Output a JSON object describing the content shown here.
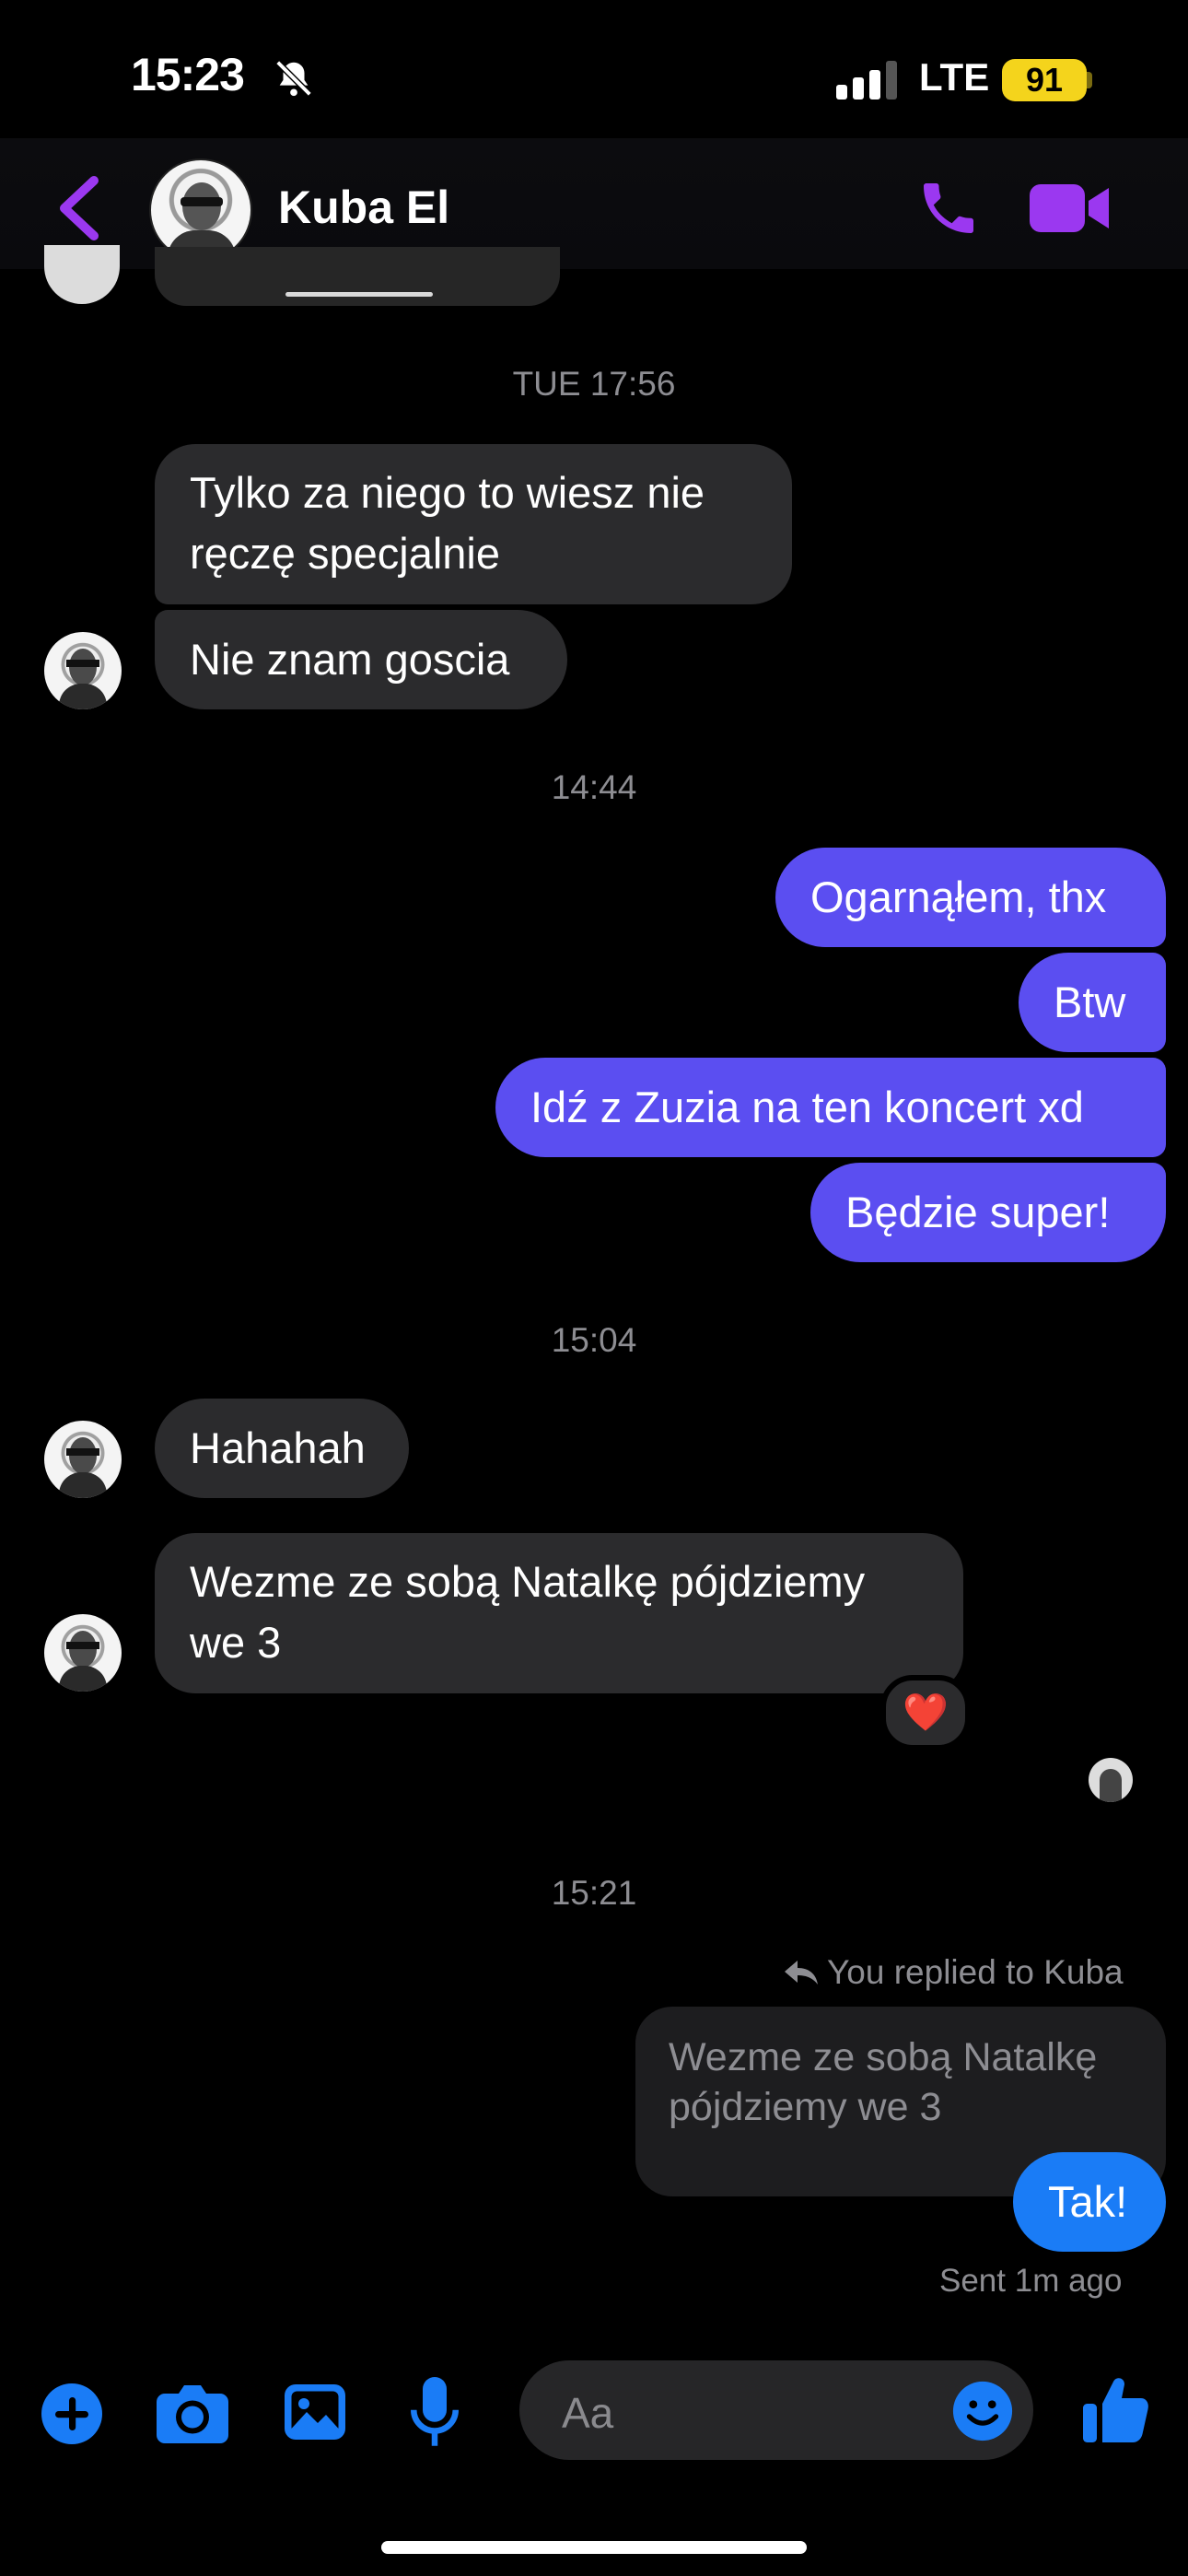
{
  "status_bar": {
    "time": "15:23",
    "network": "LTE",
    "battery": "91"
  },
  "header": {
    "contact_name": "Kuba El"
  },
  "conversation": {
    "timestamps": [
      "TUE 17:56",
      "14:44",
      "15:04",
      "15:21"
    ],
    "messages": [
      {
        "from": "them",
        "text": "Tylko za niego to wiesz nie ręczę specjalnie"
      },
      {
        "from": "them",
        "text": "Nie znam goscia"
      },
      {
        "from": "me",
        "text": "Ogarnąłem, thx"
      },
      {
        "from": "me",
        "text": "Btw"
      },
      {
        "from": "me",
        "text": "Idź z Zuzia na ten koncert xd"
      },
      {
        "from": "me",
        "text": "Będzie super!"
      },
      {
        "from": "them",
        "text": "Hahahah"
      },
      {
        "from": "them",
        "text": "Wezme ze sobą Natalkę pójdziemy we 3",
        "reaction": "❤️"
      }
    ],
    "reply": {
      "note": "You replied to Kuba",
      "quoted_text": "Wezme ze sobą Natalkę pójdziemy we 3",
      "text": "Tak!",
      "status": "Sent 1m ago"
    }
  },
  "composer": {
    "placeholder": "Aa"
  },
  "colors": {
    "accent": "#9b38f0",
    "outgoing": "#5b4ef1",
    "reply_bubble": "#1a7cf6",
    "incoming": "#2b2b2d",
    "composer_icons": "#1a7cf6"
  }
}
